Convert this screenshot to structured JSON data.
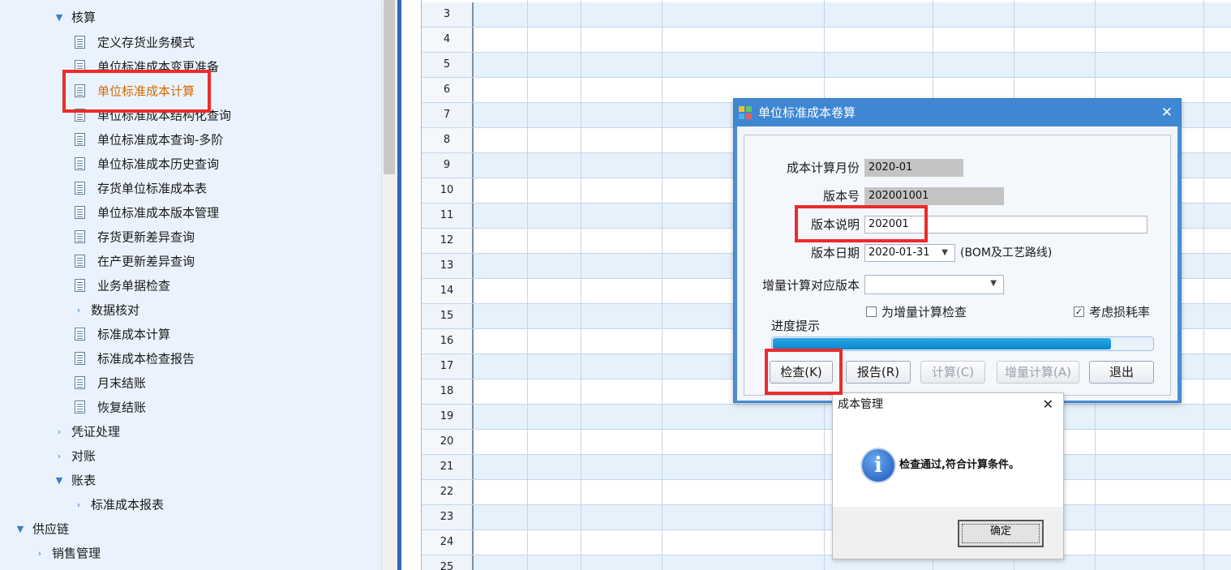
{
  "sidebar": {
    "items": [
      {
        "label": "核算",
        "kind": "group",
        "expanded": true
      },
      {
        "label": "定义存货业务模式",
        "kind": "doc"
      },
      {
        "label": "单位标准成本变更准备",
        "kind": "doc"
      },
      {
        "label": "单位标准成本计算",
        "kind": "doc",
        "active": true
      },
      {
        "label": "单位标准成本结构化查询",
        "kind": "doc"
      },
      {
        "label": "单位标准成本查询-多阶",
        "kind": "doc"
      },
      {
        "label": "单位标准成本历史查询",
        "kind": "doc"
      },
      {
        "label": "存货单位标准成本表",
        "kind": "doc"
      },
      {
        "label": "单位标准成本版本管理",
        "kind": "doc"
      },
      {
        "label": "存货更新差异查询",
        "kind": "doc"
      },
      {
        "label": "在产更新差异查询",
        "kind": "doc"
      },
      {
        "label": "业务单据检查",
        "kind": "doc"
      },
      {
        "label": "数据核对",
        "kind": "group",
        "expanded": false
      },
      {
        "label": "标准成本计算",
        "kind": "doc"
      },
      {
        "label": "标准成本检查报告",
        "kind": "doc"
      },
      {
        "label": "月末结账",
        "kind": "doc"
      },
      {
        "label": "恢复结账",
        "kind": "doc"
      },
      {
        "label": "凭证处理",
        "kind": "group",
        "expanded": false
      },
      {
        "label": "对账",
        "kind": "group",
        "expanded": false
      },
      {
        "label": "账表",
        "kind": "group",
        "expanded": true
      },
      {
        "label": "标准成本报表",
        "kind": "group",
        "expanded": false
      },
      {
        "label": "供应链",
        "kind": "group",
        "expanded": true
      },
      {
        "label": "销售管理",
        "kind": "group",
        "expanded": false
      }
    ]
  },
  "grid": {
    "row_numbers": [
      "3",
      "4",
      "5",
      "6",
      "7",
      "8",
      "9",
      "10",
      "11",
      "12",
      "13",
      "14",
      "15",
      "16",
      "17",
      "18",
      "19",
      "20",
      "21",
      "22",
      "23",
      "24",
      "25"
    ]
  },
  "dialog": {
    "title": "单位标准成本卷算",
    "close_glyph": "✕",
    "month_label": "成本计算月份",
    "month_value": "2020-01",
    "version_no_label": "版本号",
    "version_no_value": "202001001",
    "version_desc_label": "版本说明",
    "version_desc_value": "202001",
    "version_date_label": "版本日期",
    "version_date_value": "2020-01-31",
    "version_date_note": "(BOM及工艺路线)",
    "incr_version_label": "增量计算对应版本",
    "incr_version_value": "",
    "incr_check_label": "为增量计算检查",
    "incr_check_checked": false,
    "loss_rate_label": "考虑损耗率",
    "loss_rate_checked": true,
    "check_mark": "✓",
    "progress_label": "进度提示",
    "progress_fraction": 0.89,
    "buttons": {
      "check": "检查(K)",
      "report": "报告(R)",
      "compute": "计算(C)",
      "incr_compute": "增量计算(A)",
      "exit": "退出"
    }
  },
  "message_box": {
    "title": "成本管理",
    "close_glyph": "✕",
    "icon_glyph": "i",
    "text": "检查通过,符合计算条件。",
    "ok": "确定"
  },
  "icons": {
    "expanded": "▼",
    "collapsed": "›",
    "dropdown": "▼"
  },
  "colors": {
    "highlight": "#ee2a2a",
    "dialog_title": "#3f86d3",
    "active_item": "#d46a00",
    "progress": "#0b86cc"
  }
}
